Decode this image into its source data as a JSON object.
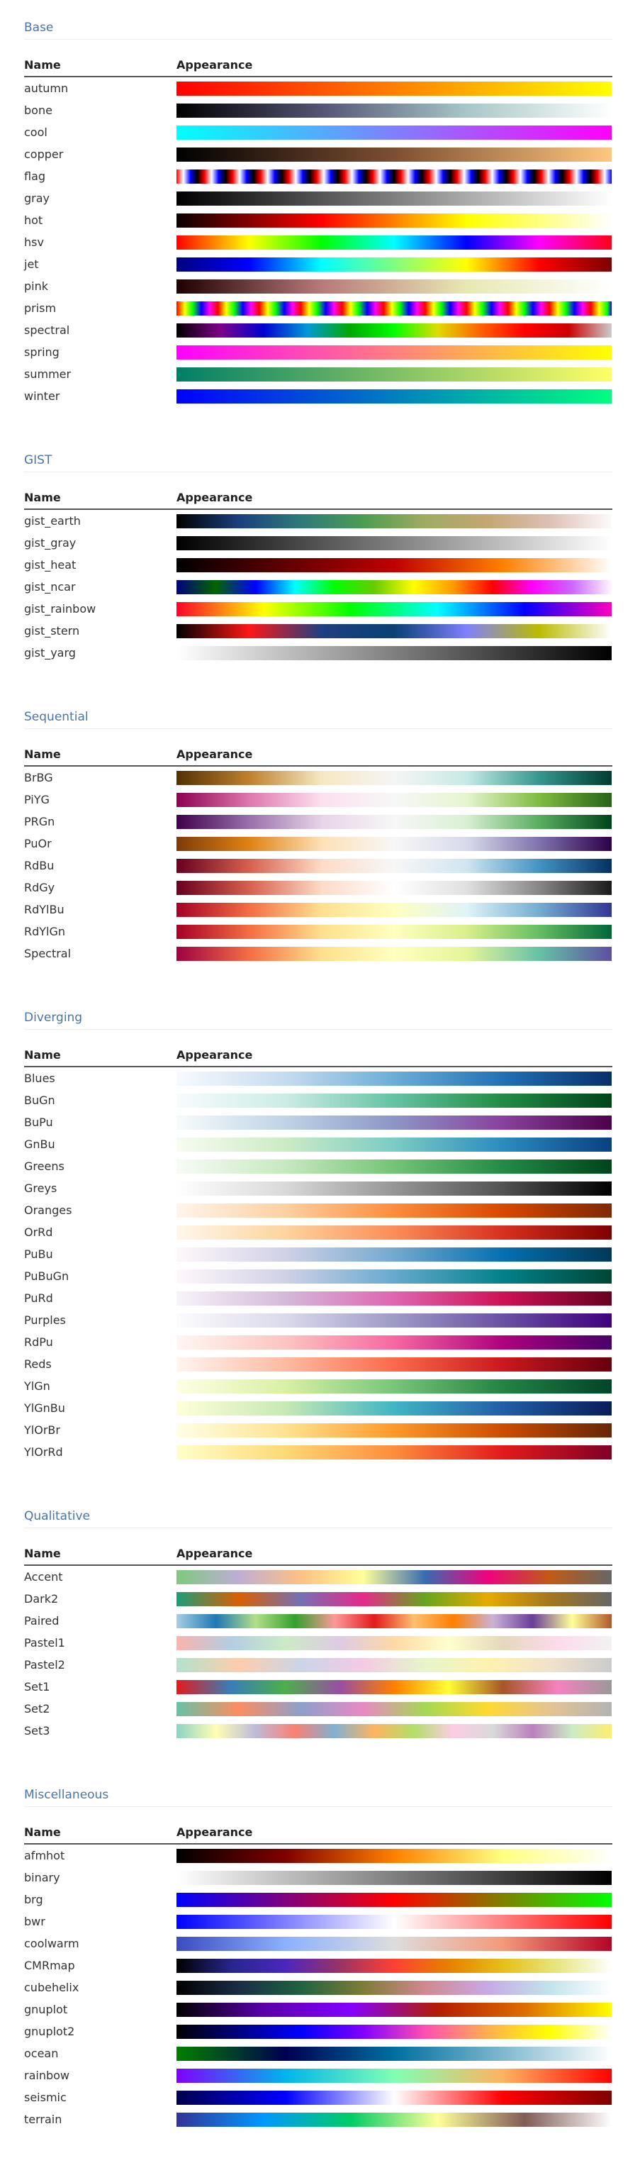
{
  "table_headers": {
    "name": "Name",
    "appearance": "Appearance"
  },
  "sections": [
    {
      "title": "Base",
      "rows": [
        {
          "name": "autumn",
          "colors": [
            "#ff0000",
            "#ff8000",
            "#ffff00"
          ]
        },
        {
          "name": "bone",
          "colors": [
            "#000000",
            "#545474",
            "#a7c7c7",
            "#ffffff"
          ]
        },
        {
          "name": "cool",
          "colors": [
            "#00ffff",
            "#ff00ff"
          ]
        },
        {
          "name": "copper",
          "colors": [
            "#000000",
            "#7d4f32",
            "#ffc77f"
          ]
        },
        {
          "name": "flag",
          "pattern": "flag",
          "cycles": 15.5,
          "colors": [
            "#ff0000",
            "#ffffff",
            "#0000ff",
            "#000000"
          ]
        },
        {
          "name": "gray",
          "colors": [
            "#000000",
            "#ffffff"
          ]
        },
        {
          "name": "hot",
          "colors": [
            "#0b0000",
            "#ff0000",
            "#ffff00",
            "#ffffff"
          ]
        },
        {
          "name": "hsv",
          "colors": [
            "#ff0000",
            "#ffff00",
            "#00ff00",
            "#00ffff",
            "#0000ff",
            "#ff00ff",
            "#ff0018"
          ]
        },
        {
          "name": "jet",
          "colors": [
            "#00007f",
            "#0000ff",
            "#00ffff",
            "#7fff7f",
            "#ffff00",
            "#ff0000",
            "#7f0000"
          ]
        },
        {
          "name": "pink",
          "colors": [
            "#1e0000",
            "#b77a7a",
            "#e8e8b4",
            "#ffffff"
          ]
        },
        {
          "name": "prism",
          "pattern": "prism",
          "cycles": 10.5,
          "colors": [
            "#ff0000",
            "#ffff00",
            "#00ff00",
            "#0000ff",
            "#ff00ff"
          ]
        },
        {
          "name": "spectral",
          "colors": [
            "#000000",
            "#7f0087",
            "#0000d0",
            "#0099d8",
            "#00a900",
            "#00ff00",
            "#dddd00",
            "#ff6000",
            "#ff0000",
            "#cc0000",
            "#cccccc"
          ]
        },
        {
          "name": "spring",
          "colors": [
            "#ff00ff",
            "#ffff00"
          ]
        },
        {
          "name": "summer",
          "colors": [
            "#007f66",
            "#ffff66"
          ]
        },
        {
          "name": "winter",
          "colors": [
            "#0000ff",
            "#00ff80"
          ]
        }
      ]
    },
    {
      "title": "GIST",
      "rows": [
        {
          "name": "gist_earth",
          "colors": [
            "#000000",
            "#1c3f7e",
            "#2e7a7a",
            "#4c9c52",
            "#a0ab63",
            "#c4a672",
            "#ddc0b6",
            "#fdfbfb"
          ]
        },
        {
          "name": "gist_gray",
          "colors": [
            "#000000",
            "#ffffff"
          ]
        },
        {
          "name": "gist_heat",
          "colors": [
            "#000000",
            "#600000",
            "#c00000",
            "#ff8000",
            "#ffffff"
          ]
        },
        {
          "name": "gist_ncar",
          "colors": [
            "#000080",
            "#006600",
            "#0000ff",
            "#00ffff",
            "#00ff00",
            "#66cc00",
            "#ffff00",
            "#ff9900",
            "#ff0000",
            "#ff00ff",
            "#cc66ff",
            "#fef8fe"
          ]
        },
        {
          "name": "gist_rainbow",
          "colors": [
            "#ff0029",
            "#ffff00",
            "#00ff00",
            "#00ffff",
            "#0000ff",
            "#ff00bf"
          ]
        },
        {
          "name": "gist_stern",
          "colors": [
            "#000000",
            "#ff1717",
            "#203f80",
            "#0a4074",
            "#8080ff",
            "#bbbb00",
            "#ffffff"
          ]
        },
        {
          "name": "gist_yarg",
          "colors": [
            "#ffffff",
            "#000000"
          ]
        }
      ]
    },
    {
      "title": "Sequential",
      "rows": [
        {
          "name": "BrBG",
          "colors": [
            "#543005",
            "#bf812d",
            "#f6e8c3",
            "#f5f5f5",
            "#c7eae5",
            "#35978f",
            "#003c30"
          ]
        },
        {
          "name": "PiYG",
          "colors": [
            "#8e0152",
            "#de77ae",
            "#fde0ef",
            "#f7f7f7",
            "#e6f5d0",
            "#7fbc41",
            "#276419"
          ]
        },
        {
          "name": "PRGn",
          "colors": [
            "#40004b",
            "#9970ab",
            "#e7d4e8",
            "#f7f7f7",
            "#d9f0d3",
            "#5aae61",
            "#00441b"
          ]
        },
        {
          "name": "PuOr",
          "colors": [
            "#7f3b08",
            "#e08214",
            "#fee0b6",
            "#f7f7f7",
            "#d8daeb",
            "#8073ac",
            "#2d004b"
          ]
        },
        {
          "name": "RdBu",
          "colors": [
            "#67001f",
            "#d6604d",
            "#fddbc7",
            "#f7f7f7",
            "#d1e5f0",
            "#4393c3",
            "#053061"
          ]
        },
        {
          "name": "RdGy",
          "colors": [
            "#67001f",
            "#d6604d",
            "#fddbc7",
            "#ffffff",
            "#e0e0e0",
            "#878787",
            "#1a1a1a"
          ]
        },
        {
          "name": "RdYlBu",
          "colors": [
            "#a50026",
            "#f46d43",
            "#fee090",
            "#ffffbf",
            "#e0f3f8",
            "#74add1",
            "#313695"
          ]
        },
        {
          "name": "RdYlGn",
          "colors": [
            "#a50026",
            "#f46d43",
            "#fee08b",
            "#ffffbf",
            "#d9ef8b",
            "#66bd63",
            "#006837"
          ]
        },
        {
          "name": "Spectral",
          "colors": [
            "#9e0142",
            "#f46d43",
            "#fee08b",
            "#ffffbf",
            "#e6f598",
            "#66c2a5",
            "#5e4fa2"
          ]
        }
      ]
    },
    {
      "title": "Diverging",
      "rows": [
        {
          "name": "Blues",
          "colors": [
            "#f7fbff",
            "#c6dbef",
            "#6baed6",
            "#2171b5",
            "#08306b"
          ]
        },
        {
          "name": "BuGn",
          "colors": [
            "#f7fcfd",
            "#ccece6",
            "#66c2a4",
            "#238b45",
            "#00441b"
          ]
        },
        {
          "name": "BuPu",
          "colors": [
            "#f7fcfd",
            "#bfd3e6",
            "#8c96c6",
            "#88419d",
            "#4d004b"
          ]
        },
        {
          "name": "GnBu",
          "colors": [
            "#f7fcf0",
            "#ccebc5",
            "#7bccc4",
            "#2b8cbe",
            "#084081"
          ]
        },
        {
          "name": "Greens",
          "colors": [
            "#f7fcf5",
            "#c7e9c0",
            "#74c476",
            "#238b45",
            "#00441b"
          ]
        },
        {
          "name": "Greys",
          "colors": [
            "#ffffff",
            "#d9d9d9",
            "#969696",
            "#525252",
            "#000000"
          ]
        },
        {
          "name": "Oranges",
          "colors": [
            "#fff5eb",
            "#fdd0a2",
            "#fd8d3c",
            "#d94801",
            "#7f2704"
          ]
        },
        {
          "name": "OrRd",
          "colors": [
            "#fff7ec",
            "#fdd49e",
            "#fc8d59",
            "#d7301f",
            "#7f0000"
          ]
        },
        {
          "name": "PuBu",
          "colors": [
            "#fff7fb",
            "#d0d1e6",
            "#74a9cf",
            "#0570b0",
            "#023858"
          ]
        },
        {
          "name": "PuBuGn",
          "colors": [
            "#fff7fb",
            "#d0d1e6",
            "#67a9cf",
            "#02818a",
            "#014636"
          ]
        },
        {
          "name": "PuRd",
          "colors": [
            "#f7f4f9",
            "#d4b9da",
            "#df65b0",
            "#ce1256",
            "#67001f"
          ]
        },
        {
          "name": "Purples",
          "colors": [
            "#fcfbfd",
            "#dadaeb",
            "#9e9ac8",
            "#6a51a3",
            "#3f007d"
          ]
        },
        {
          "name": "RdPu",
          "colors": [
            "#fff7f3",
            "#fcc5c0",
            "#f768a1",
            "#ae017e",
            "#49006a"
          ]
        },
        {
          "name": "Reds",
          "colors": [
            "#fff5f0",
            "#fcbba1",
            "#fb6a4a",
            "#cb181d",
            "#67000d"
          ]
        },
        {
          "name": "YlGn",
          "colors": [
            "#ffffe5",
            "#d9f0a3",
            "#78c679",
            "#238443",
            "#004529"
          ]
        },
        {
          "name": "YlGnBu",
          "colors": [
            "#ffffd9",
            "#c7e9b4",
            "#41b6c4",
            "#225ea8",
            "#081d58"
          ]
        },
        {
          "name": "YlOrBr",
          "colors": [
            "#ffffe5",
            "#fee391",
            "#fe9929",
            "#cc4c02",
            "#662506"
          ]
        },
        {
          "name": "YlOrRd",
          "colors": [
            "#ffffcc",
            "#fed976",
            "#fd8d3c",
            "#e31a1c",
            "#800026"
          ]
        }
      ]
    },
    {
      "title": "Qualitative",
      "rows": [
        {
          "name": "Accent",
          "colors": [
            "#7fc97f",
            "#beaed4",
            "#fdc086",
            "#ffff99",
            "#386cb0",
            "#f0027f",
            "#bf5b17",
            "#666666"
          ]
        },
        {
          "name": "Dark2",
          "colors": [
            "#1b9e77",
            "#d95f02",
            "#7570b3",
            "#e7298a",
            "#66a61e",
            "#e6ab02",
            "#a6761d",
            "#666666"
          ]
        },
        {
          "name": "Paired",
          "colors": [
            "#a6cee3",
            "#1f78b4",
            "#b2df8a",
            "#33a02c",
            "#fb9a99",
            "#e31a1c",
            "#fdbf6f",
            "#ff7f00",
            "#cab2d6",
            "#6a3d9a",
            "#ffff99",
            "#b15928"
          ]
        },
        {
          "name": "Pastel1",
          "colors": [
            "#fbb4ae",
            "#b3cde3",
            "#ccebc5",
            "#decbe4",
            "#fed9a6",
            "#ffffcc",
            "#e5d8bd",
            "#fddaec",
            "#f2f2f2"
          ]
        },
        {
          "name": "Pastel2",
          "colors": [
            "#b3e2cd",
            "#fdcdac",
            "#cbd5e8",
            "#f4cae4",
            "#e6f5c9",
            "#fff2ae",
            "#f1e2cc",
            "#cccccc"
          ]
        },
        {
          "name": "Set1",
          "colors": [
            "#e41a1c",
            "#377eb8",
            "#4daf4a",
            "#984ea3",
            "#ff7f00",
            "#ffff33",
            "#a65628",
            "#f781bf",
            "#999999"
          ]
        },
        {
          "name": "Set2",
          "colors": [
            "#66c2a5",
            "#fc8d62",
            "#8da0cb",
            "#e78ac3",
            "#a6d854",
            "#ffd92f",
            "#e5c494",
            "#b3b3b3"
          ]
        },
        {
          "name": "Set3",
          "colors": [
            "#8dd3c7",
            "#ffffb3",
            "#bebada",
            "#fb8072",
            "#80b1d3",
            "#fdb462",
            "#b3de69",
            "#fccde5",
            "#d9d9d9",
            "#bc80bd",
            "#ccebc5",
            "#ffed6f"
          ]
        }
      ]
    },
    {
      "title": "Miscellaneous",
      "rows": [
        {
          "name": "afmhot",
          "colors": [
            "#000000",
            "#800000",
            "#ff8000",
            "#ffff80",
            "#ffffff"
          ]
        },
        {
          "name": "binary",
          "colors": [
            "#ffffff",
            "#000000"
          ]
        },
        {
          "name": "brg",
          "colors": [
            "#0000ff",
            "#ff0000",
            "#00ff00"
          ]
        },
        {
          "name": "bwr",
          "colors": [
            "#0000ff",
            "#ffffff",
            "#ff0000"
          ]
        },
        {
          "name": "coolwarm",
          "colors": [
            "#3b4cc0",
            "#8db0fe",
            "#dddddd",
            "#f49a7b",
            "#b40426"
          ]
        },
        {
          "name": "CMRmap",
          "colors": [
            "#000000",
            "#26268c",
            "#4c26bf",
            "#993366",
            "#ff4033",
            "#e68000",
            "#e6bf1a",
            "#e6e680",
            "#ffffff"
          ]
        },
        {
          "name": "cubehelix",
          "colors": [
            "#000000",
            "#1a2d45",
            "#1f6240",
            "#7e7c36",
            "#d18890",
            "#c8a9e5",
            "#c2e3ec",
            "#ffffff"
          ]
        },
        {
          "name": "gnuplot",
          "colors": [
            "#000000",
            "#5a00a9",
            "#8400ff",
            "#b31c00",
            "#dd6d00",
            "#ffff00"
          ]
        },
        {
          "name": "gnuplot2",
          "colors": [
            "#000000",
            "#000080",
            "#0000ff",
            "#8000ff",
            "#ff4fb0",
            "#ffae50",
            "#ffff00",
            "#ffffff"
          ]
        },
        {
          "name": "ocean",
          "colors": [
            "#008000",
            "#000050",
            "#006f9e",
            "#80b8cf",
            "#ffffff"
          ]
        },
        {
          "name": "rainbow",
          "colors": [
            "#8000ff",
            "#00b5eb",
            "#80ffb4",
            "#ffb360",
            "#ff0000"
          ]
        },
        {
          "name": "seismic",
          "colors": [
            "#00004c",
            "#0000ff",
            "#ffffff",
            "#ff0000",
            "#800000"
          ]
        },
        {
          "name": "terrain",
          "colors": [
            "#333399",
            "#0099ff",
            "#00cc66",
            "#ffff99",
            "#815c56",
            "#ffffff"
          ]
        }
      ]
    }
  ]
}
